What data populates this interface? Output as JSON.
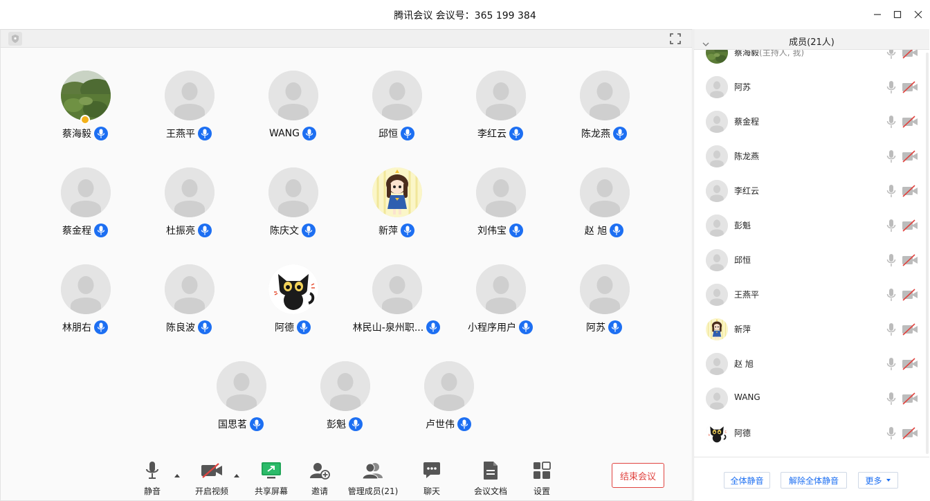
{
  "window": {
    "title": "腾讯会议 会议号：365 199 384"
  },
  "colors": {
    "accent": "#1d6ff2",
    "danger": "#e0433f",
    "host_badge": "#f3b11a"
  },
  "gallery": {
    "participants": [
      {
        "name": "蔡海毅",
        "avatar": "landscape-photo",
        "host": true
      },
      {
        "name": "王燕平",
        "avatar": "default-person"
      },
      {
        "name": "WANG",
        "avatar": "default-person"
      },
      {
        "name": "邱恒",
        "avatar": "default-person"
      },
      {
        "name": "李红云",
        "avatar": "default-person"
      },
      {
        "name": "陈龙燕",
        "avatar": "default-person"
      },
      {
        "name": "蔡金程",
        "avatar": "default-person"
      },
      {
        "name": "杜振亮",
        "avatar": "default-person"
      },
      {
        "name": "陈庆文",
        "avatar": "default-person"
      },
      {
        "name": "新萍",
        "avatar": "cartoon-girl"
      },
      {
        "name": "刘伟宝",
        "avatar": "default-person"
      },
      {
        "name": "赵 旭",
        "avatar": "default-person"
      },
      {
        "name": "林朋右",
        "avatar": "default-person"
      },
      {
        "name": "陈良波",
        "avatar": "default-person"
      },
      {
        "name": "阿德",
        "avatar": "black-cat"
      },
      {
        "name": "林民山-泉州职...",
        "avatar": "default-person"
      },
      {
        "name": "小程序用户",
        "avatar": "default-person"
      },
      {
        "name": "阿苏",
        "avatar": "default-person"
      },
      {
        "name": "国思茗",
        "avatar": "default-person"
      },
      {
        "name": "彭魁",
        "avatar": "default-person"
      },
      {
        "name": "卢世伟",
        "avatar": "default-person"
      }
    ]
  },
  "toolbar": {
    "mute": "静音",
    "video": "开启视频",
    "share": "共享屏幕",
    "invite": "邀请",
    "manage": "管理成员(21)",
    "chat": "聊天",
    "docs": "会议文档",
    "settings": "设置",
    "end": "结束会议"
  },
  "panel": {
    "title": "成员(21人)",
    "members": [
      {
        "name": "蔡海毅",
        "role": "(主持人, 我)",
        "avatar": "landscape-photo"
      },
      {
        "name": "阿苏",
        "role": "",
        "avatar": "default-person"
      },
      {
        "name": "蔡金程",
        "role": "",
        "avatar": "default-person"
      },
      {
        "name": "陈龙燕",
        "role": "",
        "avatar": "default-person"
      },
      {
        "name": "李红云",
        "role": "",
        "avatar": "default-person"
      },
      {
        "name": "彭魁",
        "role": "",
        "avatar": "default-person"
      },
      {
        "name": "邱恒",
        "role": "",
        "avatar": "default-person"
      },
      {
        "name": "王燕平",
        "role": "",
        "avatar": "default-person"
      },
      {
        "name": "新萍",
        "role": "",
        "avatar": "cartoon-girl"
      },
      {
        "name": "赵 旭",
        "role": "",
        "avatar": "default-person"
      },
      {
        "name": "WANG",
        "role": "",
        "avatar": "default-person"
      },
      {
        "name": "阿德",
        "role": "",
        "avatar": "black-cat"
      }
    ],
    "mute_all": "全体静音",
    "unmute_all": "解除全体静音",
    "more": "更多"
  }
}
